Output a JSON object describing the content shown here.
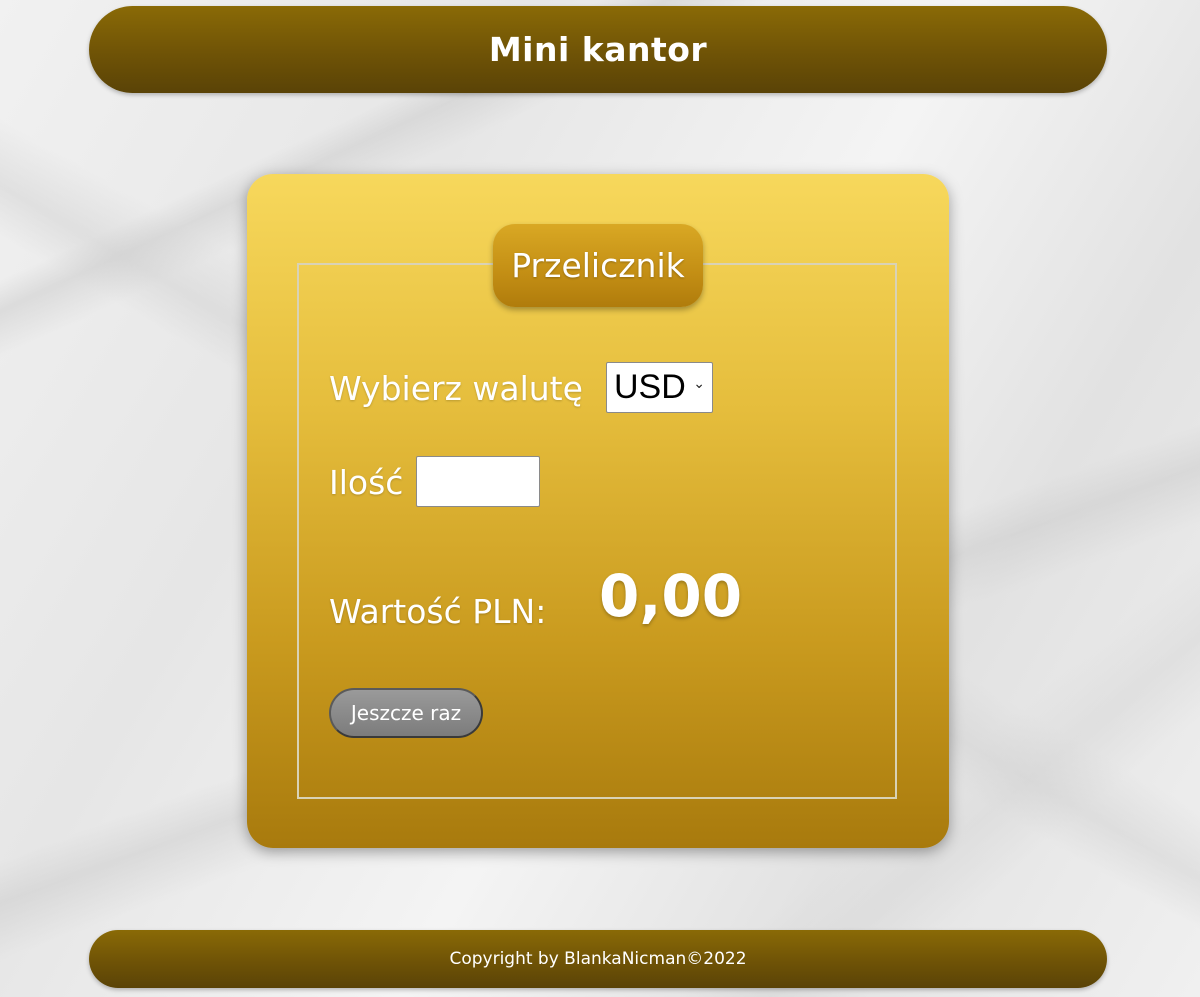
{
  "header": {
    "title": "Mini kantor"
  },
  "converter": {
    "legend": "Przelicznik",
    "currency_label": "Wybierz walutę",
    "currency_selected": "USD",
    "amount_label": "Ilość",
    "amount_value": "",
    "result_label": "Wartość PLN:",
    "result_value": "0,00",
    "reset_button": "Jeszcze raz"
  },
  "footer": {
    "text": "Copyright by BlankaNicman©2022"
  },
  "colors": {
    "header_bg": "#6f5306",
    "card_top": "#f7d85c",
    "card_bottom": "#a87a0d",
    "legend_bg": "#c38e14",
    "button_bg": "#8a8a8a"
  }
}
